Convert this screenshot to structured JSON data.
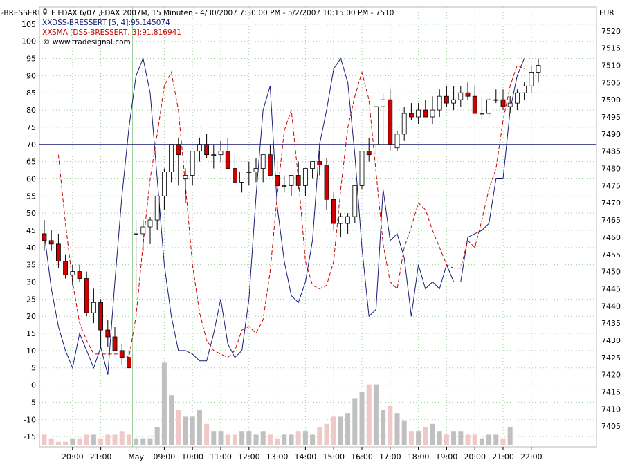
{
  "header": {
    "indicator_label": "-BRESSERT",
    "instrument_line": "F FDAX 6/07 ,FDAX 2007M, 15 Minuten - 4/30/2007 7:30:00 PM - 5/2/2007 10:15:00 PM - 7510",
    "dss_line": "DSS-BRESSERT [5, 4]:95.145074",
    "sma_line": "SMA [DSS-BRESSERT, 3]:91.816941",
    "copyright_line": "© www.tradesignal.com",
    "currency": "EUR"
  },
  "colors": {
    "dss": "#1a1a7a",
    "sma": "#cc0000",
    "hline": "#1a1a7a",
    "candle_up": "#ffffff",
    "candle_down": "#d00000",
    "volume_up": "#c0c0c0",
    "volume_down": "#f0c8c8",
    "grid": "#9fcf9f"
  },
  "chart_data": {
    "type": "candlestick",
    "left_axis": {
      "ylim": [
        -18,
        110
      ],
      "ticks": [
        105,
        100,
        95,
        90,
        85,
        80,
        75,
        70,
        65,
        60,
        55,
        50,
        45,
        40,
        35,
        30,
        25,
        20,
        15,
        10,
        5,
        0,
        -5,
        -10,
        -15
      ],
      "tick_labels": [
        "105",
        "100",
        "95",
        "90",
        "85",
        "80",
        "75",
        "70",
        "65",
        "60",
        "55",
        "50",
        "45",
        "40",
        "35",
        "30",
        "25",
        "20",
        "15",
        "10",
        "5",
        "0",
        "-5",
        "-10",
        "-15"
      ]
    },
    "right_axis": {
      "ylim": [
        7399,
        7527
      ],
      "ticks": [
        7520,
        7515,
        7510,
        7505,
        7500,
        7495,
        7490,
        7485,
        7480,
        7475,
        7470,
        7465,
        7460,
        7455,
        7450,
        7445,
        7440,
        7435,
        7430,
        7425,
        7420,
        7415,
        7410,
        7405
      ],
      "tick_labels": [
        "7520",
        "7515",
        "7510",
        "7505",
        "7500",
        "7495",
        "7490",
        "7485",
        "7480",
        "7475",
        "7470",
        "7465",
        "7460",
        "7455",
        "7450",
        "7445",
        "7440",
        "7435",
        "7430",
        "7425",
        "7420",
        "7415",
        "7410",
        "7405"
      ]
    },
    "x_axis": {
      "bars": 76,
      "labels": [
        {
          "bar": 4,
          "text": "20:00"
        },
        {
          "bar": 8,
          "text": "21:00"
        },
        {
          "bar": 13,
          "text": "May"
        },
        {
          "bar": 17,
          "text": "09:00"
        },
        {
          "bar": 21,
          "text": "10:00"
        },
        {
          "bar": 25,
          "text": "11:00"
        },
        {
          "bar": 29,
          "text": "12:00"
        },
        {
          "bar": 33,
          "text": "13:00"
        },
        {
          "bar": 37,
          "text": "14:00"
        },
        {
          "bar": 41,
          "text": "15:00"
        },
        {
          "bar": 45,
          "text": "16:00"
        },
        {
          "bar": 49,
          "text": "17:00"
        },
        {
          "bar": 53,
          "text": "18:00"
        },
        {
          "bar": 57,
          "text": "19:00"
        },
        {
          "bar": 61,
          "text": "20:00"
        },
        {
          "bar": 65,
          "text": "21:00"
        },
        {
          "bar": 69,
          "text": "22:00"
        }
      ]
    },
    "horizontal_lines": [
      70,
      30
    ],
    "day_separator_bar": 12.5,
    "candles": {
      "open": [
        7461,
        7459,
        7458,
        7453,
        7449,
        7450,
        7448,
        7438,
        7441,
        7433,
        7431,
        7427,
        7425,
        7461,
        7461,
        7463,
        7465,
        7472,
        7479,
        7487,
        7477,
        7478,
        7485,
        7487,
        7484,
        7484,
        7485,
        7480,
        7476,
        7479,
        7479,
        7480,
        7484,
        7478,
        7475,
        7475,
        7478,
        7475,
        7480,
        7482,
        7481,
        7471,
        7464,
        7464,
        7466,
        7475,
        7485,
        7487,
        7498,
        7500,
        7486,
        7490,
        7496,
        7495,
        7497,
        7495,
        7497,
        7501,
        7499,
        7500,
        7502,
        7501,
        7496,
        7496,
        7500,
        7500,
        7498,
        7499,
        7502,
        7504,
        7508
      ],
      "high": [
        7465,
        7462,
        7461,
        7455,
        7452,
        7452,
        7450,
        7445,
        7442,
        7436,
        7434,
        7429,
        7427,
        7465,
        7465,
        7466,
        7472,
        7480,
        7487,
        7489,
        7480,
        7484,
        7489,
        7490,
        7487,
        7488,
        7489,
        7484,
        7479,
        7482,
        7483,
        7484,
        7487,
        7482,
        7478,
        7478,
        7482,
        7480,
        7482,
        7485,
        7483,
        7473,
        7467,
        7467,
        7475,
        7485,
        7489,
        7498,
        7502,
        7503,
        7491,
        7498,
        7499,
        7499,
        7500,
        7501,
        7503,
        7504,
        7504,
        7504,
        7505,
        7504,
        7501,
        7501,
        7503,
        7503,
        7501,
        7503,
        7505,
        7510,
        7512
      ],
      "low": [
        7456,
        7456,
        7451,
        7448,
        7446,
        7447,
        7437,
        7435,
        7428,
        7428,
        7428,
        7423,
        7422,
        7443,
        7456,
        7458,
        7462,
        7468,
        7476,
        7475,
        7470,
        7475,
        7482,
        7483,
        7480,
        7482,
        7483,
        7476,
        7473,
        7475,
        7476,
        7476,
        7478,
        7474,
        7473,
        7472,
        7474,
        7472,
        7477,
        7478,
        7468,
        7462,
        7460,
        7461,
        7464,
        7474,
        7482,
        7484,
        7487,
        7485,
        7485,
        7488,
        7494,
        7493,
        7495,
        7493,
        7495,
        7498,
        7497,
        7498,
        7500,
        7497,
        7494,
        7495,
        7499,
        7497,
        7496,
        7497,
        7500,
        7502,
        7505
      ],
      "close": [
        7459,
        7458,
        7453,
        7449,
        7450,
        7448,
        7438,
        7441,
        7433,
        7431,
        7427,
        7425,
        7422,
        7461,
        7463,
        7465,
        7472,
        7479,
        7487,
        7484,
        7478,
        7485,
        7487,
        7484,
        7484,
        7485,
        7480,
        7476,
        7479,
        7479,
        7480,
        7484,
        7478,
        7475,
        7475,
        7478,
        7475,
        7480,
        7482,
        7481,
        7471,
        7464,
        7466,
        7466,
        7475,
        7485,
        7484,
        7498,
        7500,
        7487,
        7490,
        7496,
        7495,
        7497,
        7495,
        7497,
        7501,
        7499,
        7500,
        7502,
        7501,
        7496,
        7496,
        7500,
        7500,
        7498,
        7499,
        7502,
        7504,
        7508,
        7510
      ]
    },
    "volume": [
      3,
      2,
      1,
      1,
      2,
      2,
      3,
      3,
      2,
      3,
      3,
      4,
      3,
      2,
      2,
      2,
      5,
      23,
      14,
      10,
      8,
      8,
      10,
      6,
      4,
      4,
      3,
      3,
      4,
      4,
      3,
      4,
      3,
      2,
      3,
      3,
      4,
      4,
      3,
      5,
      6,
      8,
      8,
      9,
      13,
      15,
      17,
      17,
      10,
      11,
      9,
      7,
      4,
      4,
      5,
      6,
      4,
      3,
      4,
      4,
      3,
      3,
      2,
      3,
      3,
      2,
      5
    ]
  },
  "series_lines": {
    "dss_values": [
      44,
      28,
      17,
      10,
      5,
      15,
      10,
      5,
      11,
      3,
      30,
      55,
      75,
      90,
      95,
      85,
      60,
      35,
      20,
      10,
      10,
      9,
      7,
      7,
      15,
      25,
      12,
      8,
      10,
      25,
      55,
      80,
      87,
      52,
      36,
      26,
      24,
      30,
      42,
      70,
      80,
      92,
      95,
      88,
      67,
      40,
      20,
      22,
      57,
      42,
      44,
      37,
      20,
      35,
      28,
      30,
      28,
      35,
      30,
      30,
      43,
      44,
      45,
      47,
      60,
      60,
      80,
      90,
      95
    ],
    "sma_values": [
      67,
      47,
      30,
      18,
      13,
      9,
      9,
      9,
      9,
      9,
      8,
      20,
      41,
      60,
      73,
      87,
      91,
      80,
      58,
      35,
      21,
      13,
      10,
      9,
      8,
      10,
      16,
      17,
      15,
      19,
      33,
      55,
      74,
      80,
      60,
      36,
      29,
      28,
      29,
      36,
      57,
      75,
      84,
      91,
      83,
      62,
      41,
      30,
      28,
      40,
      46,
      53,
      51,
      45,
      40,
      35,
      34,
      34,
      42,
      40,
      48,
      57,
      63,
      77,
      87,
      93,
      92
    ]
  }
}
